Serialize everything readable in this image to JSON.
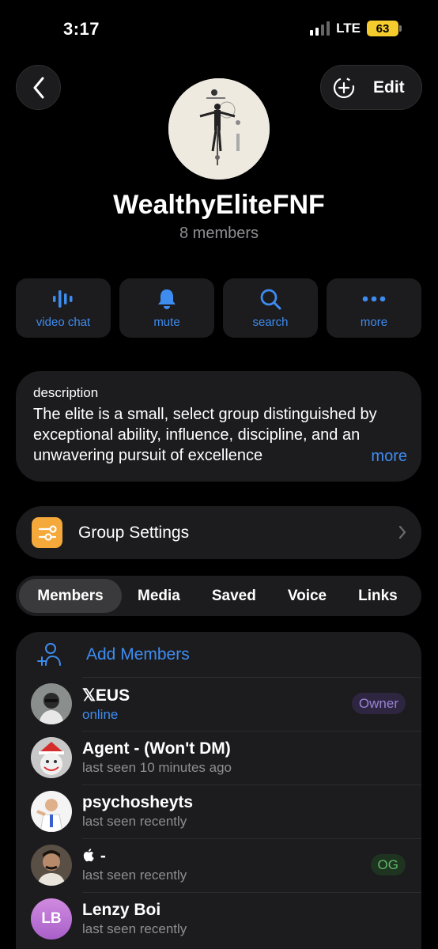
{
  "status_bar": {
    "time": "3:17",
    "network": "LTE",
    "battery": "63"
  },
  "header": {
    "edit_label": "Edit"
  },
  "group": {
    "title": "WealthyEliteFNF",
    "subtitle": "8 members"
  },
  "actions": [
    {
      "label": "video chat",
      "icon": "waveform-icon"
    },
    {
      "label": "mute",
      "icon": "bell-icon"
    },
    {
      "label": "search",
      "icon": "search-icon"
    },
    {
      "label": "more",
      "icon": "more-dots-icon"
    }
  ],
  "description": {
    "heading": "description",
    "text": "The elite is a small, select group distinguished by exceptional ability, influence, discipline, and an unwavering pursuit of excellence",
    "more_label": "more"
  },
  "settings": {
    "label": "Group Settings"
  },
  "tabs": [
    "Members",
    "Media",
    "Saved",
    "Voice",
    "Links"
  ],
  "members": {
    "add_label": "Add Members",
    "list": [
      {
        "name": "𝕏EUS",
        "status": "online",
        "badge": "Owner"
      },
      {
        "name": "Agent - (Won't DM)",
        "status": "last seen 10 minutes ago",
        "badge": ""
      },
      {
        "name": "psychosheyts",
        "status": "last seen recently",
        "badge": ""
      },
      {
        "name": " -",
        "status": "last seen recently",
        "badge": "OG"
      },
      {
        "name": "Lenzy Boi",
        "status": "last seen recently",
        "badge": "",
        "initials": "LB"
      }
    ]
  },
  "colors": {
    "accent": "#3e8cf0",
    "card": "#1c1c1e",
    "settings_icon": "#f6a93b",
    "battery": "#f5cc2d"
  }
}
